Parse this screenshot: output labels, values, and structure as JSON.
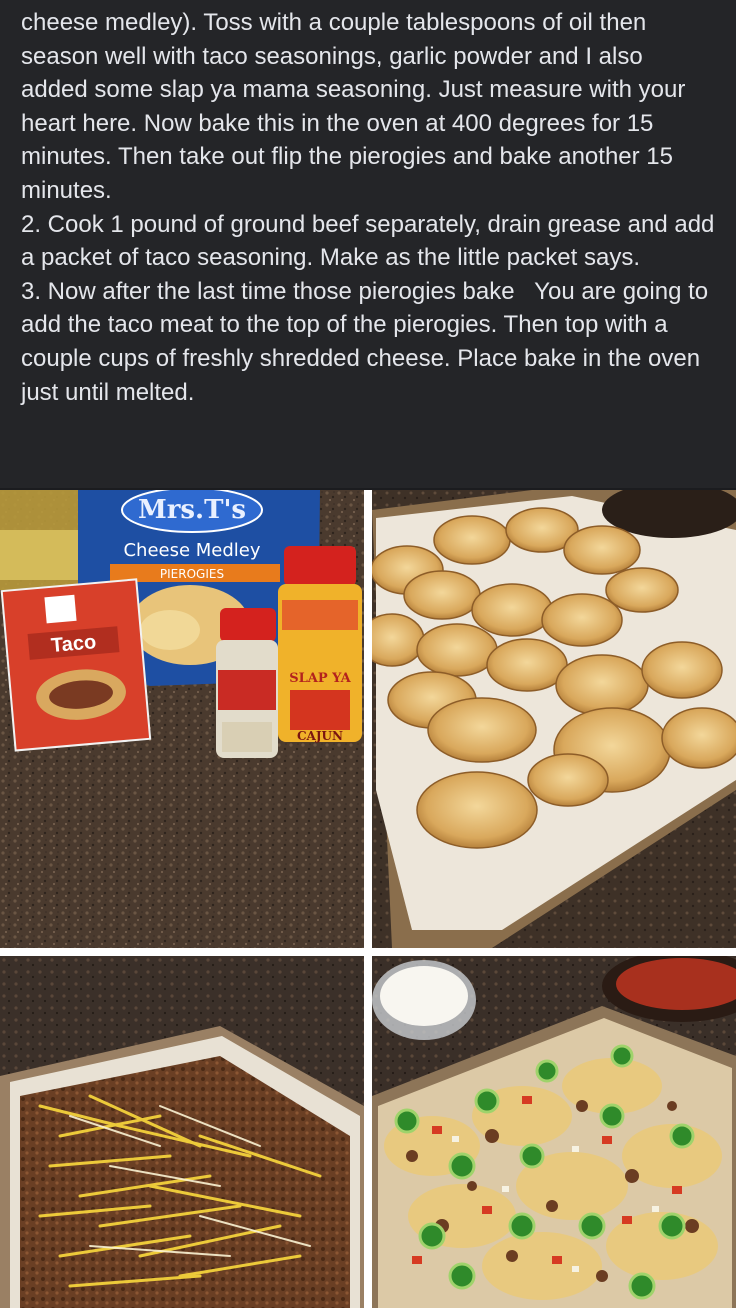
{
  "post": {
    "paragraphs": [
      "cheese medley). Toss with a couple tablespoons of oil then season well with taco seasonings, garlic powder and I also added some slap ya mama seasoning. Just measure with your heart here. Now bake this in the oven at 400 degrees for 15 minutes. Then take out flip the pierogies and bake another 15 minutes.",
      "2. Cook 1 pound of ground beef separately, drain grease and add a packet of taco seasoning. Make as the little packet says.",
      "3. Now after the last time those pierogies bake   You are going to add the taco meat to the top of the pierogies. Then top with a couple cups of freshly shredded cheese. Place bake in the oven just until melted."
    ]
  },
  "photos": {
    "ingredients": {
      "brand": "Mrs.T's",
      "bag_label": "Cheese Medley",
      "bag_sublabel": "PIEROGIES",
      "packet_label": "Taco",
      "can_label_top": "SLAP YA",
      "can_label_bottom": "CAJUN"
    }
  },
  "colors": {
    "background": "#242528",
    "text": "#e4e6eb",
    "granite": "#4a3a2e"
  }
}
